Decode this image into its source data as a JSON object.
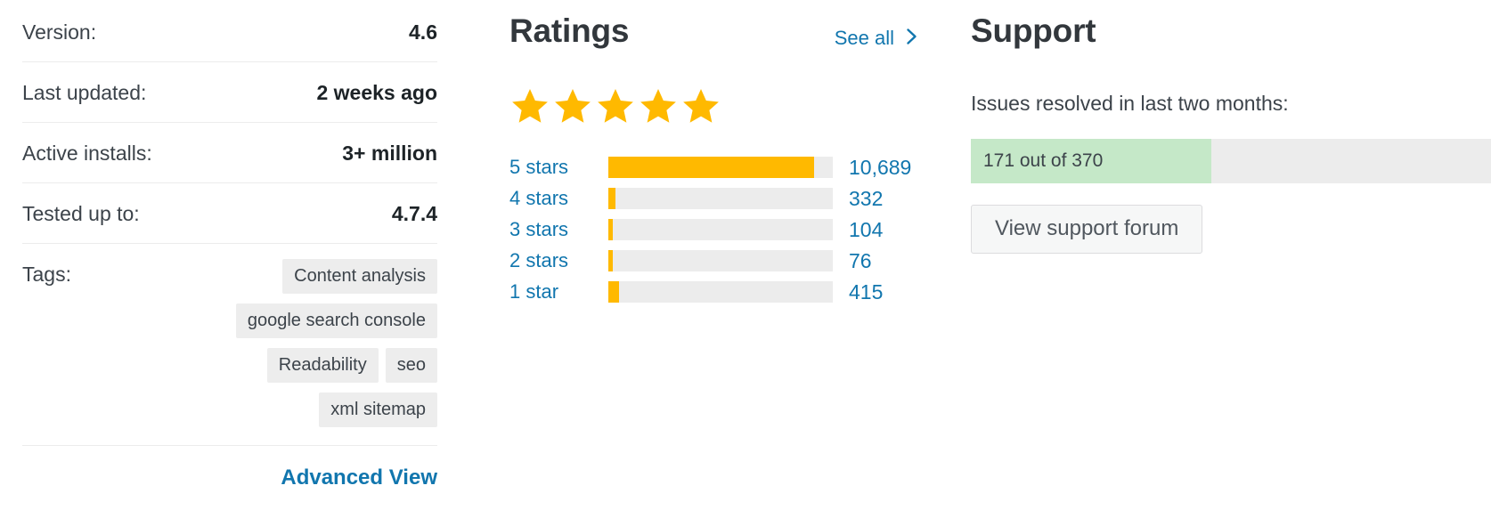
{
  "meta": {
    "rows": [
      {
        "label": "Version:",
        "value": "4.6"
      },
      {
        "label": "Last updated:",
        "value": "2 weeks ago"
      },
      {
        "label": "Active installs:",
        "value": "3+ million"
      },
      {
        "label": "Tested up to:",
        "value": "4.7.4"
      }
    ],
    "tags_label": "Tags:",
    "tags": [
      "Content analysis",
      "google search console",
      "Readability",
      "seo",
      "xml sitemap"
    ],
    "advanced_view_label": "Advanced View"
  },
  "ratings": {
    "title": "Ratings",
    "see_all_label": "See all",
    "see_all_chevron": "chevron-right-icon",
    "star_count": 5,
    "star_color": "#ffb900"
  },
  "support": {
    "title": "Support",
    "subtitle": "Issues resolved in last two months:",
    "progress_text": "171 out of 370",
    "resolved": 171,
    "total": 370,
    "fill_color": "#c5e8c8",
    "track_color": "#ececec",
    "forum_button_label": "View support forum"
  },
  "chart_data": {
    "type": "bar",
    "title": "Ratings",
    "orientation": "horizontal",
    "categories": [
      "5 stars",
      "4 stars",
      "3 stars",
      "2 stars",
      "1 star"
    ],
    "values": [
      10689,
      332,
      104,
      76,
      415
    ],
    "value_labels": [
      "10,689",
      "332",
      "104",
      "76",
      "415"
    ],
    "bar_fill_pct": [
      91.5,
      3.1,
      1.8,
      1.8,
      4.8
    ],
    "bar_color": "#ffb900",
    "track_color": "#ececec",
    "xlabel": "",
    "ylabel": "",
    "grid": false,
    "legend": "none"
  },
  "colors": {
    "link": "#1176ae",
    "text": "#32373c",
    "muted": "#3c434a",
    "divider": "#ececec",
    "tag_bg": "#ededed",
    "star": "#ffb900",
    "support_green": "#c5e8c8"
  }
}
